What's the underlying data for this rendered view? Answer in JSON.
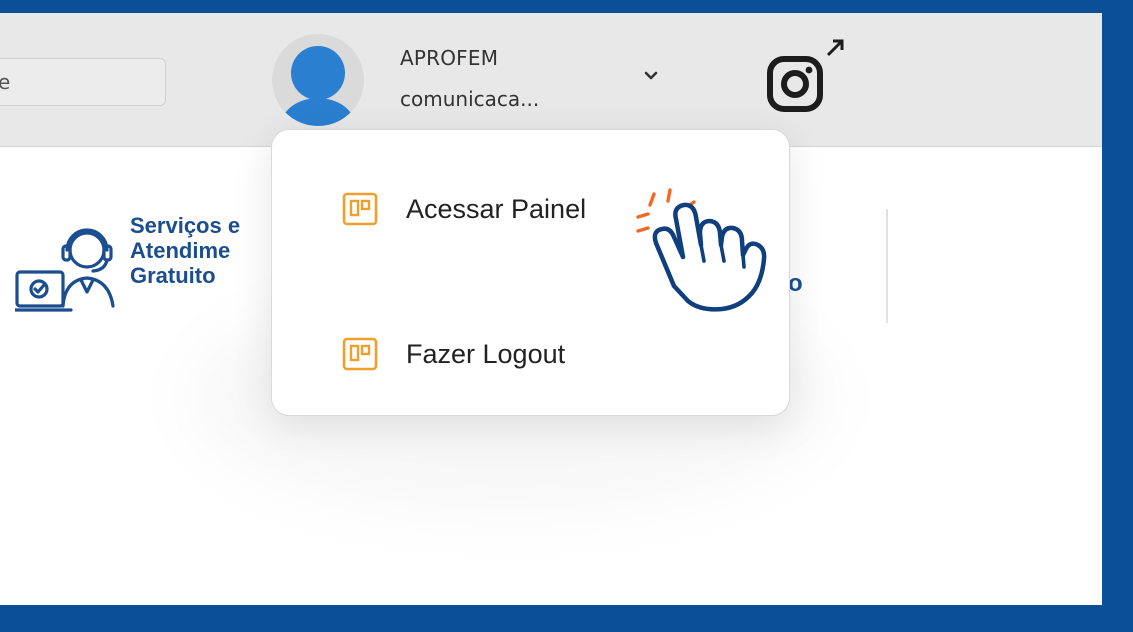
{
  "search": {
    "value": "e"
  },
  "user": {
    "name": "APROFEM",
    "email": "comunicaca..."
  },
  "services": {
    "lines": [
      "Serviços e",
      "Atendime",
      "Gratuito"
    ]
  },
  "right_fragment": "o",
  "menu": {
    "items": [
      {
        "label": "Acessar Painel"
      },
      {
        "label": "Fazer Logout"
      }
    ]
  },
  "colors": {
    "outer_background": "#0b4f97",
    "avatar": "#2a7fd0",
    "brand_text": "#1b4e8f",
    "menu_icon": "#f0a02a",
    "click_burst": "#f26a21"
  },
  "icons": [
    "user-avatar-icon",
    "chevron-down-icon",
    "instagram-icon",
    "external-link-icon",
    "support-agent-icon",
    "dashboard-icon",
    "pointing-hand-icon"
  ]
}
